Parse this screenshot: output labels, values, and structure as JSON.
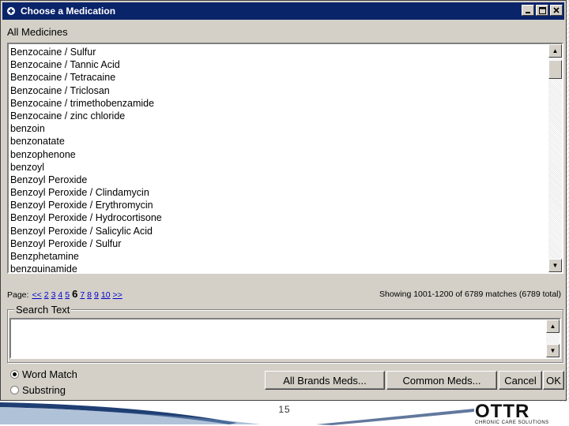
{
  "window": {
    "title": "Choose a Medication",
    "icon": "app-icon",
    "controls": [
      "minimize-icon",
      "maximize-icon",
      "close-icon"
    ]
  },
  "list_label": "All Medicines",
  "medicines": [
    "Benzocaine / Sulfur",
    "Benzocaine / Tannic Acid",
    "Benzocaine / Tetracaine",
    "Benzocaine / Triclosan",
    "Benzocaine / trimethobenzamide",
    "Benzocaine / zinc chloride",
    "benzoin",
    "benzonatate",
    "benzophenone",
    "benzoyl",
    "Benzoyl Peroxide",
    "Benzoyl Peroxide / Clindamycin",
    "Benzoyl Peroxide / Erythromycin",
    "Benzoyl Peroxide / Hydrocortisone",
    "Benzoyl Peroxide / Salicylic Acid",
    "Benzoyl Peroxide / Sulfur",
    "Benzphetamine",
    "benzquinamide"
  ],
  "pager": {
    "label": "Page:",
    "prev": "<<",
    "pages_before": [
      "2",
      "3",
      "4",
      "5"
    ],
    "current": "6",
    "pages_after": [
      "7",
      "8",
      "9",
      "10"
    ],
    "next": ">>"
  },
  "showing_text": "Showing 1001-1200 of 6789 matches (6789 total)",
  "search": {
    "group_label": "Search Text",
    "value": ""
  },
  "match_options": [
    {
      "label": "Word Match",
      "checked": true
    },
    {
      "label": "Substring",
      "checked": false
    }
  ],
  "buttons": {
    "all_brands": "All Brands Meds...",
    "common": "Common Meds...",
    "cancel": "Cancel",
    "ok": "OK"
  },
  "slide": {
    "page_number": "15",
    "logo_text": "OTTR",
    "logo_tagline": "CHRONIC CARE SOLUTIONS"
  },
  "colors": {
    "titlebar": "#0a246a",
    "dialog_face": "#d4d0c8",
    "link": "#0000cc"
  }
}
